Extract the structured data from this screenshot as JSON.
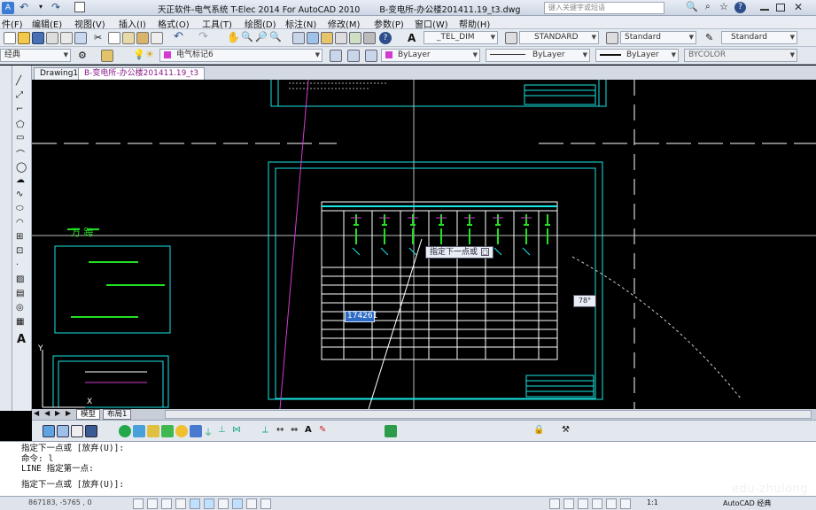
{
  "title_bar": {
    "app": "天正软件-电气系统 T-Elec 2014  For AutoCAD 2010",
    "file": "B-变电所-办公楼201411.19_t3.dwg",
    "search_placeholder": "键入关键字或短语"
  },
  "menu": [
    "件(F)",
    "编辑(E)",
    "视图(V)",
    "插入(I)",
    "格式(O)",
    "工具(T)",
    "绘图(D)",
    "标注(N)",
    "修改(M)",
    "参数(P)",
    "窗口(W)",
    "帮助(H)"
  ],
  "styles": {
    "dim_style": "_TEL_DIM",
    "text_style": "STANDARD",
    "table_style": "Standard",
    "multileader_style": "Standard"
  },
  "layers": {
    "workspace": "经典",
    "current_layer": "电气标记6",
    "color": "ByLayer",
    "linetype": "ByLayer",
    "lineweight": "ByLayer",
    "plotstyle": "BYCOLOR"
  },
  "doc_tabs": [
    "Drawing1",
    "B-变电所-办公楼201411.19_t3"
  ],
  "viewport": {
    "tooltip_prompt": "指定下一点或",
    "coord_input": "174261",
    "angle_tooltip": "78°",
    "view_label_left": "万  跨"
  },
  "layout_tabs": [
    "模型",
    "布局1"
  ],
  "command_lines": [
    "指定下一点或 [放弃(U)]:",
    "命令: l",
    "LINE 指定第一点:",
    "",
    "指定下一点或 [放弃(U)]:"
  ],
  "status": {
    "coords": "867183, -5765 ,  0",
    "scale": "1:1",
    "watermark": "edu-zhulong",
    "workspace": "AutoCAD 经典"
  },
  "colors": {
    "ribbon_bg": "#e6ebf2",
    "cad_bg": "#000000",
    "accent_cyan": "#19e6e6",
    "accent_green": "#22e022",
    "accent_magenta": "#d23cd2"
  }
}
